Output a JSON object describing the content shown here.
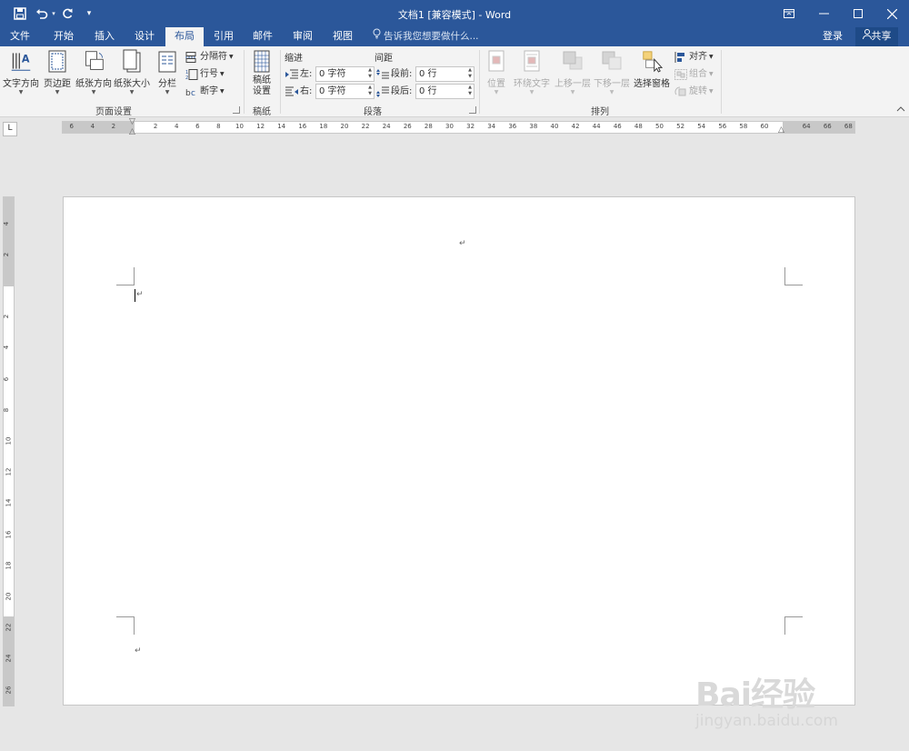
{
  "window": {
    "title": "文档1 [兼容模式] - Word"
  },
  "quick_access": {
    "save_icon": "save-icon",
    "undo_icon": "undo-icon",
    "redo_icon": "redo-icon",
    "customize_icon": "customize-icon"
  },
  "tabs": [
    {
      "label": "文件"
    },
    {
      "label": "开始"
    },
    {
      "label": "插入"
    },
    {
      "label": "设计"
    },
    {
      "label": "布局",
      "active": true
    },
    {
      "label": "引用"
    },
    {
      "label": "邮件"
    },
    {
      "label": "审阅"
    },
    {
      "label": "视图"
    }
  ],
  "tell_me": "告诉我您想要做什么...",
  "account": {
    "login": "登录",
    "share": "共享"
  },
  "ribbon": {
    "page_setup": {
      "group_label": "页面设置",
      "text_direction": "文字方向",
      "margins": "页边距",
      "orientation": "纸张方向",
      "size": "纸张大小",
      "columns": "分栏",
      "breaks": "分隔符",
      "line_numbers": "行号",
      "hyphenation": "断字"
    },
    "manuscript": {
      "group_label": "稿纸",
      "button_line1": "稿纸",
      "button_line2": "设置"
    },
    "paragraph": {
      "group_label": "段落",
      "indent_header": "缩进",
      "spacing_header": "间距",
      "left_label": "左:",
      "right_label": "右:",
      "left_value": "0 字符",
      "right_value": "0 字符",
      "before_label": "段前:",
      "after_label": "段后:",
      "before_value": "0 行",
      "after_value": "0 行"
    },
    "arrange": {
      "group_label": "排列",
      "position": "位置",
      "wrap_text": "环绕文字",
      "bring_forward": "上移一层",
      "send_backward": "下移一层",
      "selection_pane": "选择窗格",
      "align": "对齐",
      "group": "组合",
      "rotate": "旋转"
    }
  },
  "ruler": {
    "tab_selector": "L",
    "h_numbers": [
      "6",
      "4",
      "2",
      "2",
      "4",
      "6",
      "8",
      "10",
      "12",
      "14",
      "16",
      "18",
      "20",
      "22",
      "24",
      "26",
      "28",
      "30",
      "32",
      "34",
      "36",
      "38",
      "40",
      "42",
      "44",
      "46",
      "48",
      "50",
      "52",
      "54",
      "56",
      "58",
      "60",
      "64",
      "66",
      "68"
    ],
    "v_numbers": [
      "4",
      "2",
      "2",
      "4",
      "6",
      "8",
      "10",
      "12",
      "14",
      "16",
      "18",
      "20",
      "22",
      "24",
      "26"
    ]
  },
  "document": {
    "paragraph_mark": "↵"
  },
  "watermark": {
    "main": "Bai经验",
    "sub": "jingyan.baidu.com"
  }
}
